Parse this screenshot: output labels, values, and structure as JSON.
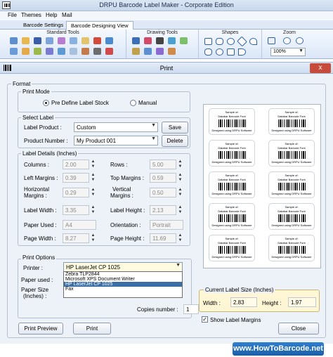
{
  "app": {
    "title": "DRPU Barcode Label Maker - Corporate Edition"
  },
  "menu": [
    "File",
    "Themes",
    "Help",
    "Mail"
  ],
  "ribbon_tabs": [
    "Barcode Settings",
    "Barcode Designing View"
  ],
  "ribbon_groups": {
    "standard": "Standard Tools",
    "drawing": "Drawing Tools",
    "shapes": "Shapes",
    "zoom": "Zoom",
    "zoom_value": "100%"
  },
  "dialog": {
    "title": "Print",
    "close_glyph": "x",
    "format_legend": "Format",
    "print_mode": {
      "legend": "Print Mode",
      "opt1": "Pre Define Label Stock",
      "opt2": "Manual"
    },
    "select_label": {
      "legend": "Select Label",
      "product_label": "Label Product :",
      "product_value": "Custom",
      "save": "Save",
      "number_label": "Product Number :",
      "number_value": "My Product 001",
      "delete": "Delete"
    },
    "details": {
      "legend": "Label Details (Inches)",
      "columns_l": "Columns :",
      "columns_v": "2.00",
      "rows_l": "Rows :",
      "rows_v": "5.00",
      "left_l": "Left Margins :",
      "left_v": "0.39",
      "top_l": "Top Margins :",
      "top_v": "0.59",
      "hmarg_l1": "Horizontal",
      "hmarg_l2": "Margins :",
      "hmarg_v": "0.29",
      "vmarg_l1": "Vertical",
      "vmarg_l2": "Margins :",
      "vmarg_v": "0.50",
      "lw_l": "Label Width :",
      "lw_v": "3.35",
      "lh_l": "Label Height :",
      "lh_v": "2.13",
      "paper_l": "Paper Used :",
      "paper_v": "A4",
      "orient_l": "Orientation :",
      "orient_v": "Portrait",
      "pw_l": "Page Width :",
      "pw_v": "8.27",
      "ph_l": "Page Height :",
      "ph_v": "11.69"
    },
    "print_options": {
      "legend": "Print Options",
      "printer_l": "Printer :",
      "printer_v": "HP LaserJet CP 1025",
      "printer_list": [
        "Zebra TLP2844",
        "Microsoft XPS Document Writer",
        "HP LaserJet CP 1025",
        "Fax"
      ],
      "paper_used_l": "Paper used :",
      "paper_size_l1": "Paper Size",
      "paper_size_l2": "(Inches) :",
      "copies_l": "Copies number :",
      "copies_v": "1"
    },
    "current_size": {
      "legend": "Current Label Size (Inches)",
      "width_l": "Width :",
      "width_v": "2.83",
      "height_l": "Height :",
      "height_v": "1.97"
    },
    "show_margins": "Show Label Margins",
    "buttons": {
      "preview": "Print Preview",
      "print": "Print",
      "close": "Close"
    },
    "preview_card": {
      "line1": "Sample of:",
      "line2": "Databar Barcode Font",
      "line3": "Designed using DRPU Software"
    }
  },
  "footer": "www.HowToBarcode.net"
}
